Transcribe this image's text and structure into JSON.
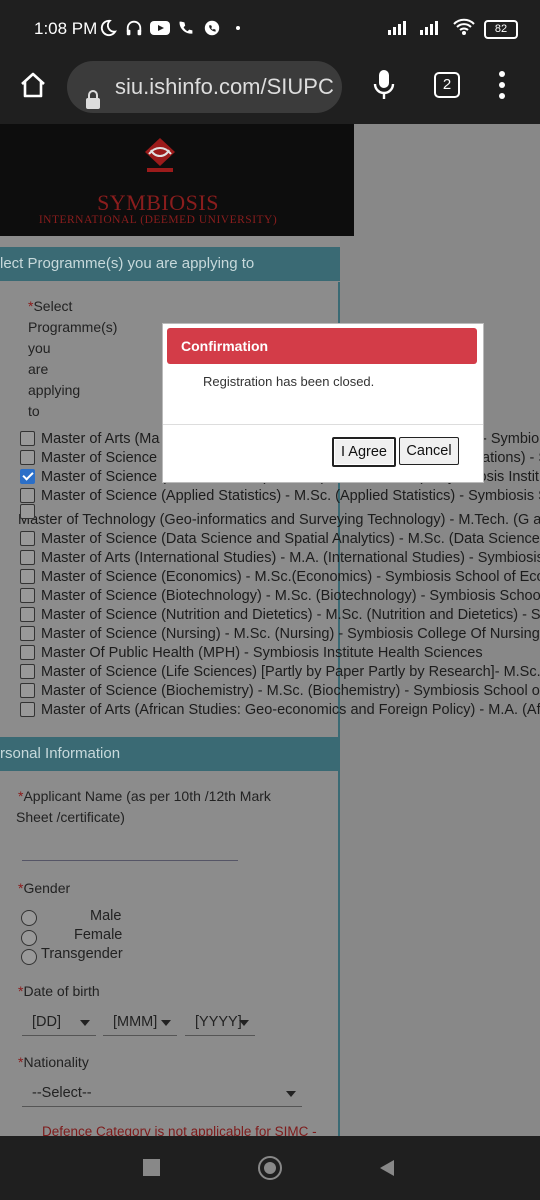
{
  "status_bar": {
    "time": "1:08 PM",
    "battery": "82"
  },
  "browser": {
    "url": "siu.ishinfo.com/SIUPC",
    "tab_count": "2"
  },
  "logo": {
    "name": "SYMBIOSIS",
    "subtitle": "INTERNATIONAL (DEEMED UNIVERSITY)"
  },
  "programmes": {
    "section_title": "lect Programme(s) you are applying to",
    "label_lines": [
      "Select",
      "Programme(s)",
      "you",
      "are",
      "applying",
      "to"
    ],
    "items": [
      {
        "label": "Master of Arts (Ma",
        "tail": "- Symbio",
        "checked": false
      },
      {
        "label": "Master of Science",
        "tail": "ations) - S",
        "checked": false
      },
      {
        "label": "Master of Science (Geoinformatics) - M.Sc.(Geoinformatics) - Symbiosis Instit",
        "checked": true
      },
      {
        "label": "Master of Science (Applied Statistics) - M.Sc. (Applied Statistics) - Symbiosis S",
        "checked": false
      },
      {
        "label": "Master of Technology (Geo-informatics and Surveying Technology) - M.Tech. (G an",
        "checked": false
      },
      {
        "label": "Master of Science (Data Science and Spatial Analytics) - M.Sc. (Data Science a",
        "checked": false
      },
      {
        "label": "Master of Arts (International Studies) - M.A. (International Studies) - Symbiosis",
        "checked": false
      },
      {
        "label": "Master of Science (Economics) - M.Sc.(Economics) - Symbiosis School of Eco",
        "checked": false
      },
      {
        "label": "Master of Science (Biotechnology) - M.Sc. (Biotechnology) - Symbiosis School",
        "checked": false
      },
      {
        "label": "Master of Science (Nutrition and Dietetics) - M.Sc. (Nutrition and Dietetics) - Sy",
        "checked": false
      },
      {
        "label": "Master of Science (Nursing) - M.Sc. (Nursing) - Symbiosis College Of Nursing",
        "checked": false
      },
      {
        "label": "Master Of Public Health (MPH) - Symbiosis Institute Health Sciences",
        "checked": false
      },
      {
        "label": "Master of Science (Life Sciences) [Partly by Paper Partly by Research]- M.Sc. (",
        "checked": false
      },
      {
        "label": "Master of Science (Biochemistry) - M.Sc. (Biochemistry) - Symbiosis School of",
        "checked": false
      },
      {
        "label": "Master of Arts (African Studies: Geo-economics and Foreign Policy) - M.A. (Afr",
        "checked": false
      }
    ]
  },
  "personal": {
    "section_title": "rsonal Information",
    "applicant_name_line1": "Applicant Name (as per 10th /12th Mark",
    "applicant_name_line2": "Sheet /certificate)",
    "gender_label": "Gender",
    "gender_options": [
      "Male",
      "Female",
      "Transgender"
    ],
    "dob_label": "Date of birth",
    "dob_day": "[DD]",
    "dob_month": "[MMM]",
    "dob_year": "[YYYY]",
    "nationality_label": "Nationality",
    "nationality_value": "--Select--",
    "defence_note": "Defence Category is not applicable for SIMC -"
  },
  "dialog": {
    "title": "Confirmation",
    "message": "Registration has been closed.",
    "agree_label": "I Agree",
    "cancel_label": "Cancel"
  },
  "colors": {
    "dialog_header": "#d33c48",
    "section_header": "#3a6a74",
    "required_star": "#8b1a1a"
  }
}
